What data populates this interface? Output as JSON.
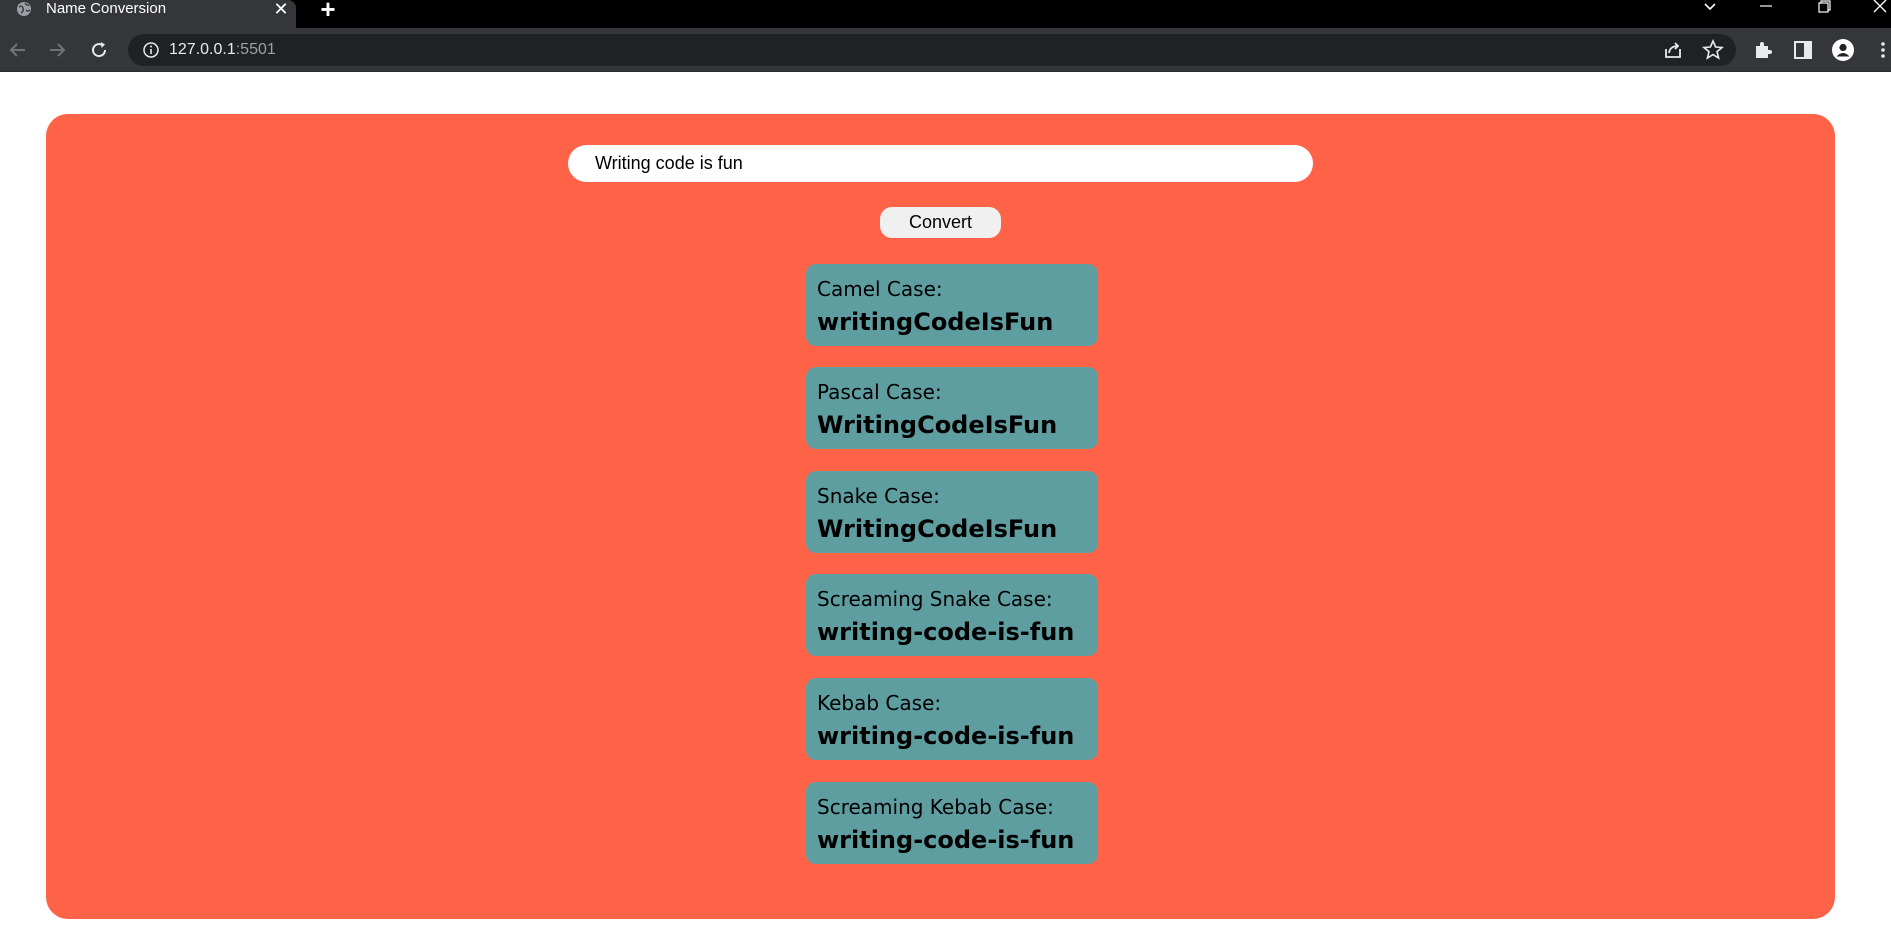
{
  "browser": {
    "tab_title": "Name Conversion",
    "tab_close": "✕",
    "new_tab": "+",
    "url_host": "127.0.0.1",
    "url_port": ":5501",
    "icons": [
      "globe-icon",
      "back-icon",
      "forward-icon",
      "reload-icon",
      "info-icon",
      "share-icon",
      "star-icon",
      "extensions-icon",
      "side-panel-icon",
      "profile-icon",
      "menu-icon",
      "tab-search-icon",
      "minimize-icon",
      "restore-icon",
      "close-window-icon"
    ]
  },
  "form": {
    "input_value": "Writing code is fun",
    "convert_label": "Convert"
  },
  "results": [
    {
      "label": "Camel Case:",
      "value": "writingCodeIsFun"
    },
    {
      "label": "Pascal Case:",
      "value": "WritingCodeIsFun"
    },
    {
      "label": "Snake Case:",
      "value": "WritingCodeIsFun"
    },
    {
      "label": "Screaming Snake Case:",
      "value": "writing-code-is-fun"
    },
    {
      "label": "Kebab Case:",
      "value": "writing-code-is-fun"
    },
    {
      "label": "Screaming Kebab Case:",
      "value": "writing-code-is-fun"
    }
  ],
  "colors": {
    "panel": "#ff6347",
    "card": "#5f9ea0",
    "chrome_dark": "#35363a",
    "tabstrip": "#000000"
  }
}
